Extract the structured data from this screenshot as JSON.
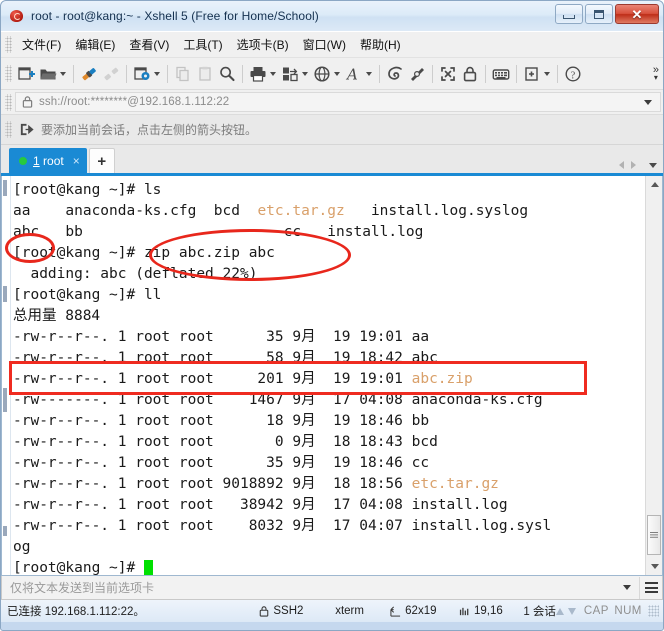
{
  "window": {
    "title": "root - root@kang:~ - Xshell 5 (Free for Home/School)",
    "icon": "xshell-icon",
    "minimize_label": "–",
    "maximize_label": "□",
    "close_label": "✕"
  },
  "menubar": {
    "items": [
      {
        "label": "文件(F)",
        "name": "menu-file"
      },
      {
        "label": "编辑(E)",
        "name": "menu-edit"
      },
      {
        "label": "查看(V)",
        "name": "menu-view"
      },
      {
        "label": "工具(T)",
        "name": "menu-tools"
      },
      {
        "label": "选项卡(B)",
        "name": "menu-tabs"
      },
      {
        "label": "窗口(W)",
        "name": "menu-window"
      },
      {
        "label": "帮助(H)",
        "name": "menu-help"
      }
    ]
  },
  "toolbar": {
    "items": [
      "new-session-icon",
      "open-folder-icon",
      "connect-icon",
      "disconnect-icon",
      "properties-icon",
      "copy-icon",
      "paste-icon",
      "search-icon",
      "print-icon",
      "file-transfer-icon",
      "globe-icon",
      "font-icon",
      "ssh-tunnel-icon",
      "compose-icon",
      "fullscreen-icon",
      "lock-icon",
      "keyboard-icon",
      "add-to-folder-icon",
      "help-icon"
    ],
    "overflow_label": "»"
  },
  "address": {
    "lock_icon": "lock-icon",
    "value": "ssh://root:********@192.168.1.112:22",
    "dropdown_icon": "chevron-down-icon"
  },
  "notice": {
    "icon": "add-session-icon",
    "text": "要添加当前会话，点击左侧的箭头按钮。"
  },
  "tabs": {
    "active": {
      "number": "1",
      "label": " root",
      "close_label": "×",
      "status_color": "#27c93f"
    },
    "new_tab_label": "+",
    "nav": [
      "prev-tab-icon",
      "next-tab-icon",
      "tab-list-icon"
    ]
  },
  "terminal": {
    "cols_rows": "62x19",
    "lines": [
      {
        "segments": [
          {
            "text": "[root@kang ~]# ls",
            "style": "def"
          }
        ]
      },
      {
        "segments": [
          {
            "text": "aa    anaconda-ks.cfg  bcd  ",
            "style": "def"
          },
          {
            "text": "etc.tar.gz",
            "style": "arch"
          },
          {
            "text": "   install.log.syslog",
            "style": "def"
          }
        ]
      },
      {
        "segments": [
          {
            "text": "abc   bb                       cc   install.log",
            "style": "def"
          }
        ]
      },
      {
        "segments": [
          {
            "text": "[root@kang ~]# zip abc.zip abc",
            "style": "def"
          }
        ]
      },
      {
        "segments": [
          {
            "text": "  adding: abc (deflated 22%)",
            "style": "def"
          }
        ]
      },
      {
        "segments": [
          {
            "text": "[root@kang ~]# ll",
            "style": "def"
          }
        ]
      },
      {
        "segments": [
          {
            "text": "总用量 8884",
            "style": "def"
          }
        ]
      },
      {
        "segments": [
          {
            "text": "-rw-r--r--. 1 root root      35 9月  19 19:01 aa",
            "style": "def"
          }
        ]
      },
      {
        "segments": [
          {
            "text": "-rw-r--r--. 1 root root      58 9月  19 18:42 abc",
            "style": "def"
          }
        ]
      },
      {
        "segments": [
          {
            "text": "-rw-r--r--. 1 root root     201 9月  19 19:01 ",
            "style": "def"
          },
          {
            "text": "abc.zip",
            "style": "arch"
          }
        ]
      },
      {
        "segments": [
          {
            "text": "-rw-------. 1 root root    1467 9月  17 04:08 anaconda-ks.cfg",
            "style": "def"
          }
        ]
      },
      {
        "segments": [
          {
            "text": "-rw-r--r--. 1 root root      18 9月  19 18:46 bb",
            "style": "def"
          }
        ]
      },
      {
        "segments": [
          {
            "text": "-rw-r--r--. 1 root root       0 9月  18 18:43 bcd",
            "style": "def"
          }
        ]
      },
      {
        "segments": [
          {
            "text": "-rw-r--r--. 1 root root      35 9月  19 18:46 cc",
            "style": "def"
          }
        ]
      },
      {
        "segments": [
          {
            "text": "-rw-r--r--. 1 root root 9018892 9月  18 18:56 ",
            "style": "def"
          },
          {
            "text": "etc.tar.gz",
            "style": "arch"
          }
        ]
      },
      {
        "segments": [
          {
            "text": "-rw-r--r--. 1 root root   38942 9月  17 04:08 install.log",
            "style": "def"
          }
        ]
      },
      {
        "segments": [
          {
            "text": "-rw-r--r--. 1 root root    8032 9月  17 04:07 install.log.sysl",
            "style": "def"
          }
        ]
      },
      {
        "segments": [
          {
            "text": "og",
            "style": "def"
          }
        ]
      },
      {
        "segments": [
          {
            "text": "[root@kang ~]# ",
            "style": "def"
          }
        ],
        "cursor": true
      }
    ]
  },
  "sendbar": {
    "placeholder": "仅将文本发送到当前选项卡",
    "dropdown_icon": "chevron-down-icon",
    "menu_icon": "hamburger-icon"
  },
  "statusbar": {
    "connection": "已连接 192.168.1.112:22。",
    "protocol": "SSH2",
    "terminal_type": "xterm",
    "size": "62x19",
    "cursor_pos": "19,16",
    "sessions": "1 会话",
    "caps": "CAP",
    "num": "NUM"
  },
  "annotations": {
    "colors": {
      "ellipse": "#e8271c",
      "rect": "#ef2b20"
    },
    "items": [
      {
        "name": "annotation-ellipse-abc",
        "shape": "ellipse"
      },
      {
        "name": "annotation-ellipse-zip-command",
        "shape": "ellipse"
      },
      {
        "name": "annotation-rect-abc-zip-row",
        "shape": "rect"
      }
    ]
  }
}
